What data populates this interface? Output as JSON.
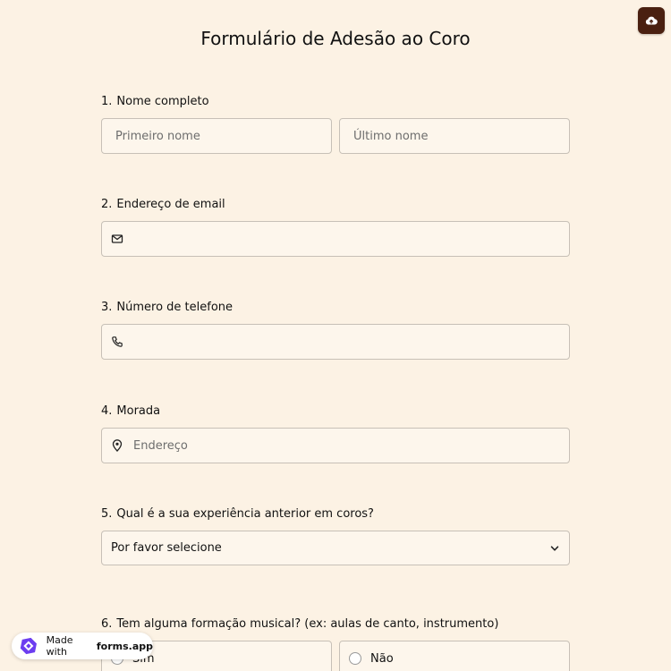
{
  "header": {
    "title": "Formulário de Adesão ao Coro",
    "save_icon": "cloud-upload-icon"
  },
  "questions": [
    {
      "number": "1.",
      "label": "Nome completo",
      "first_name_placeholder": "Primeiro nome",
      "last_name_placeholder": "Último nome"
    },
    {
      "number": "2.",
      "label": "Endereço de email",
      "icon": "envelope-icon",
      "value": ""
    },
    {
      "number": "3.",
      "label": "Número de telefone",
      "icon": "phone-icon",
      "value": ""
    },
    {
      "number": "4.",
      "label": "Morada",
      "icon": "location-pin-icon",
      "placeholder": "Endereço"
    },
    {
      "number": "5.",
      "label": "Qual é a sua experiência anterior em coros?",
      "selected": "Por favor selecione",
      "icon": "chevron-down-icon"
    },
    {
      "number": "6.",
      "label": "Tem alguma formação musical? (ex: aulas de canto, instrumento)",
      "options": [
        "Sim",
        "Não"
      ]
    }
  ],
  "badge": {
    "prefix": "Made with",
    "brand": "forms.app"
  },
  "colors": {
    "background": "#fcf2e4",
    "save_button": "#4a2010",
    "brand_logo": "#6c3df0"
  }
}
